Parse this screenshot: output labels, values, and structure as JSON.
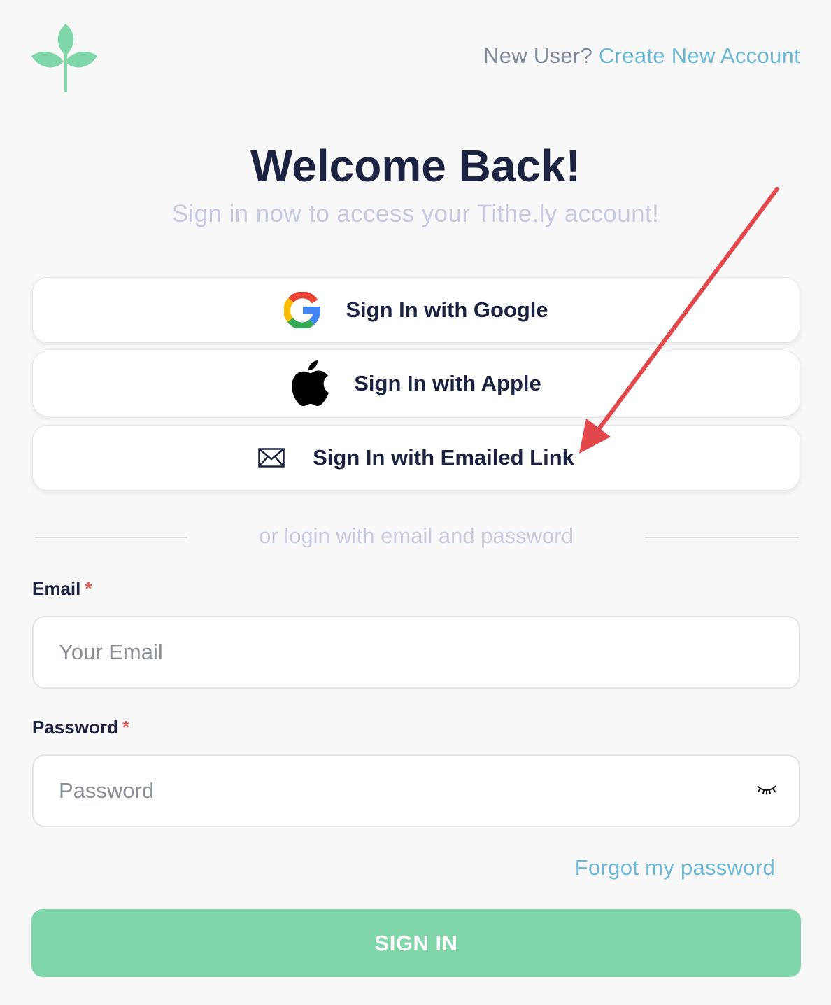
{
  "header": {
    "logo_icon": "leaf-sprout-logo",
    "new_user_text": "New User?",
    "create_account_link": "Create New Account"
  },
  "main": {
    "title": "Welcome Back!",
    "subtitle": "Sign in now to access your Tithe.ly account!"
  },
  "social_buttons": [
    {
      "label": "Sign In with Google",
      "icon": "google-icon"
    },
    {
      "label": "Sign In with Apple",
      "icon": "apple-icon"
    },
    {
      "label": "Sign In with Emailed Link",
      "icon": "envelope-icon"
    }
  ],
  "divider_text": "or login with email and password",
  "form": {
    "email": {
      "label": "Email",
      "required_mark": "*",
      "placeholder": "Your Email",
      "value": ""
    },
    "password": {
      "label": "Password",
      "required_mark": "*",
      "placeholder": "Password",
      "value": "",
      "toggle_icon": "eye-closed-icon"
    },
    "forgot_link": "Forgot my password",
    "submit_label": "SIGN IN"
  },
  "colors": {
    "brand_green": "#7fd6a8",
    "link_blue": "#6cb7d4",
    "heading": "#1c2340",
    "annotation_arrow": "#e2474b"
  }
}
